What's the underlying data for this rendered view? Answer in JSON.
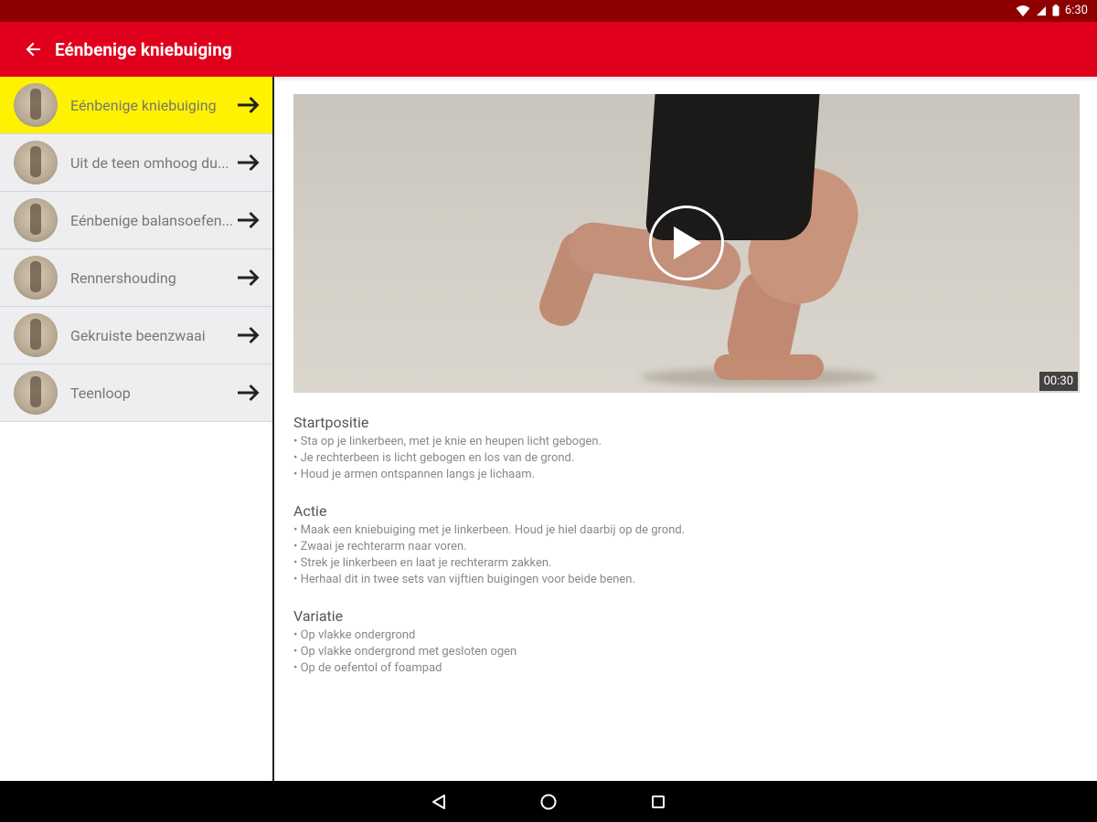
{
  "status": {
    "time": "6:30"
  },
  "header": {
    "title": "Eénbenige kniebuiging",
    "back_icon": "arrow-left-icon"
  },
  "sidebar": {
    "items": [
      {
        "label": "Eénbenige kniebuiging",
        "active": true
      },
      {
        "label": "Uit de teen omhoog du...",
        "active": false
      },
      {
        "label": "Eénbenige balansoefen...",
        "active": false
      },
      {
        "label": "Rennershouding",
        "active": false
      },
      {
        "label": "Gekruiste beenzwaai",
        "active": false
      },
      {
        "label": "Teenloop",
        "active": false
      }
    ]
  },
  "video": {
    "duration": "00:30",
    "play_icon": "play-icon"
  },
  "sections": [
    {
      "title": "Startpositie",
      "lines": [
        "• Sta op je linkerbeen, met je knie en heupen licht gebogen.",
        "• Je rechterbeen is licht gebogen en los van de grond.",
        "• Houd je armen ontspannen langs je lichaam."
      ]
    },
    {
      "title": "Actie",
      "lines": [
        "• Maak een kniebuiging met je linkerbeen. Houd je hiel daarbij op de grond.",
        "• Zwaai je rechterarm naar voren.",
        "• Strek je linkerbeen en laat je rechterarm zakken.",
        "• Herhaal dit in twee sets van vijftien buigingen voor beide benen."
      ]
    },
    {
      "title": "Variatie",
      "lines": [
        "• Op vlakke ondergrond",
        "• Op vlakke ondergrond met gesloten ogen",
        "• Op de oefentol of foampad"
      ]
    }
  ],
  "colors": {
    "status_bar": "#8e0000",
    "app_bar": "#e0001b",
    "active_item": "#fff200"
  }
}
